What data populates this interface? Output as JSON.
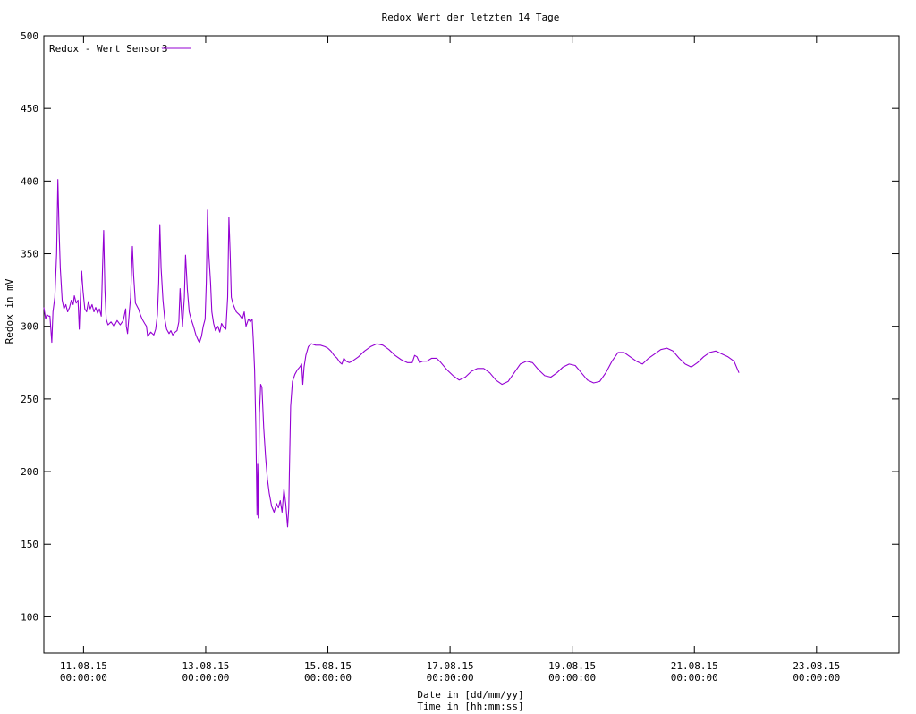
{
  "chart_data": {
    "type": "line",
    "title": "Redox Wert der letzten 14 Tage",
    "ylabel": "Redox in mV",
    "xlabel_lines": [
      "Date in [dd/mm/yy]",
      "Time in [hh:mm:ss]"
    ],
    "ylim": [
      75,
      500
    ],
    "y_ticks": [
      100,
      150,
      200,
      250,
      300,
      350,
      400,
      450,
      500
    ],
    "xlim": [
      -0.65,
      13.35
    ],
    "x_ticks": [
      {
        "x": 0,
        "date": "11.08.15",
        "time": "00:00:00"
      },
      {
        "x": 2,
        "date": "13.08.15",
        "time": "00:00:00"
      },
      {
        "x": 4,
        "date": "15.08.15",
        "time": "00:00:00"
      },
      {
        "x": 6,
        "date": "17.08.15",
        "time": "00:00:00"
      },
      {
        "x": 8,
        "date": "19.08.15",
        "time": "00:00:00"
      },
      {
        "x": 10,
        "date": "21.08.15",
        "time": "00:00:00"
      },
      {
        "x": 12,
        "date": "23.08.15",
        "time": "00:00:00"
      }
    ],
    "x_unit_note": "x in days relative to 11.08.15 00:00:00",
    "legend_position": "top-left",
    "grid": false,
    "series": [
      {
        "name": "Redox - Wert Sensor3",
        "color": "#9400d3",
        "points": [
          [
            -0.65,
            313
          ],
          [
            -0.62,
            305
          ],
          [
            -0.6,
            308
          ],
          [
            -0.57,
            307
          ],
          [
            -0.55,
            307
          ],
          [
            -0.52,
            289
          ],
          [
            -0.5,
            310
          ],
          [
            -0.47,
            320
          ],
          [
            -0.44,
            350
          ],
          [
            -0.42,
            401
          ],
          [
            -0.4,
            365
          ],
          [
            -0.38,
            340
          ],
          [
            -0.35,
            318
          ],
          [
            -0.32,
            312
          ],
          [
            -0.29,
            315
          ],
          [
            -0.26,
            310
          ],
          [
            -0.23,
            313
          ],
          [
            -0.2,
            318
          ],
          [
            -0.17,
            315
          ],
          [
            -0.15,
            321
          ],
          [
            -0.12,
            316
          ],
          [
            -0.09,
            318
          ],
          [
            -0.07,
            298
          ],
          [
            -0.05,
            322
          ],
          [
            -0.03,
            338
          ],
          [
            -0.01,
            325
          ],
          [
            0.02,
            312
          ],
          [
            0.05,
            310
          ],
          [
            0.08,
            317
          ],
          [
            0.11,
            312
          ],
          [
            0.14,
            315
          ],
          [
            0.17,
            310
          ],
          [
            0.2,
            313
          ],
          [
            0.23,
            309
          ],
          [
            0.26,
            312
          ],
          [
            0.29,
            307
          ],
          [
            0.31,
            340
          ],
          [
            0.33,
            366
          ],
          [
            0.35,
            325
          ],
          [
            0.37,
            305
          ],
          [
            0.4,
            301
          ],
          [
            0.45,
            303
          ],
          [
            0.5,
            300
          ],
          [
            0.55,
            304
          ],
          [
            0.6,
            301
          ],
          [
            0.65,
            304
          ],
          [
            0.69,
            312
          ],
          [
            0.7,
            300
          ],
          [
            0.72,
            295
          ],
          [
            0.75,
            310
          ],
          [
            0.77,
            320
          ],
          [
            0.8,
            355
          ],
          [
            0.82,
            335
          ],
          [
            0.85,
            316
          ],
          [
            0.9,
            312
          ],
          [
            0.93,
            308
          ],
          [
            0.96,
            305
          ],
          [
            1.0,
            302
          ],
          [
            1.03,
            300
          ],
          [
            1.05,
            293
          ],
          [
            1.1,
            296
          ],
          [
            1.15,
            294
          ],
          [
            1.18,
            298
          ],
          [
            1.21,
            308
          ],
          [
            1.23,
            330
          ],
          [
            1.25,
            370
          ],
          [
            1.27,
            340
          ],
          [
            1.3,
            318
          ],
          [
            1.33,
            305
          ],
          [
            1.36,
            298
          ],
          [
            1.4,
            295
          ],
          [
            1.43,
            297
          ],
          [
            1.46,
            294
          ],
          [
            1.5,
            296
          ],
          [
            1.53,
            297
          ],
          [
            1.56,
            303
          ],
          [
            1.58,
            326
          ],
          [
            1.6,
            312
          ],
          [
            1.62,
            300
          ],
          [
            1.65,
            320
          ],
          [
            1.67,
            349
          ],
          [
            1.7,
            325
          ],
          [
            1.73,
            310
          ],
          [
            1.76,
            305
          ],
          [
            1.8,
            300
          ],
          [
            1.84,
            294
          ],
          [
            1.88,
            290
          ],
          [
            1.9,
            289
          ],
          [
            1.93,
            293
          ],
          [
            1.96,
            300
          ],
          [
            1.99,
            305
          ],
          [
            2.01,
            330
          ],
          [
            2.03,
            380
          ],
          [
            2.05,
            350
          ],
          [
            2.08,
            330
          ],
          [
            2.1,
            310
          ],
          [
            2.13,
            302
          ],
          [
            2.16,
            297
          ],
          [
            2.2,
            300
          ],
          [
            2.23,
            296
          ],
          [
            2.26,
            302
          ],
          [
            2.3,
            299
          ],
          [
            2.33,
            298
          ],
          [
            2.36,
            320
          ],
          [
            2.38,
            375
          ],
          [
            2.4,
            350
          ],
          [
            2.42,
            320
          ],
          [
            2.45,
            315
          ],
          [
            2.5,
            310
          ],
          [
            2.55,
            308
          ],
          [
            2.6,
            305
          ],
          [
            2.63,
            310
          ],
          [
            2.66,
            300
          ],
          [
            2.7,
            305
          ],
          [
            2.73,
            303
          ],
          [
            2.76,
            305
          ],
          [
            2.78,
            290
          ],
          [
            2.8,
            270
          ],
          [
            2.82,
            230
          ],
          [
            2.84,
            170
          ],
          [
            2.85,
            205
          ],
          [
            2.86,
            168
          ],
          [
            2.88,
            240
          ],
          [
            2.9,
            260
          ],
          [
            2.92,
            258
          ],
          [
            2.95,
            230
          ],
          [
            2.98,
            210
          ],
          [
            3.01,
            195
          ],
          [
            3.04,
            185
          ],
          [
            3.08,
            176
          ],
          [
            3.12,
            172
          ],
          [
            3.16,
            178
          ],
          [
            3.19,
            175
          ],
          [
            3.22,
            180
          ],
          [
            3.25,
            172
          ],
          [
            3.28,
            188
          ],
          [
            3.31,
            178
          ],
          [
            3.34,
            162
          ],
          [
            3.36,
            175
          ],
          [
            3.37,
            200
          ],
          [
            3.39,
            245
          ],
          [
            3.42,
            262
          ],
          [
            3.46,
            267
          ],
          [
            3.5,
            270
          ],
          [
            3.54,
            272
          ],
          [
            3.57,
            274
          ],
          [
            3.59,
            260
          ],
          [
            3.61,
            272
          ],
          [
            3.64,
            280
          ],
          [
            3.68,
            286
          ],
          [
            3.73,
            288
          ],
          [
            3.8,
            287
          ],
          [
            3.88,
            287
          ],
          [
            3.95,
            286
          ],
          [
            4.0,
            285
          ],
          [
            4.05,
            283
          ],
          [
            4.1,
            280
          ],
          [
            4.15,
            278
          ],
          [
            4.2,
            275
          ],
          [
            4.23,
            274
          ],
          [
            4.26,
            278
          ],
          [
            4.3,
            276
          ],
          [
            4.35,
            275
          ],
          [
            4.4,
            276
          ],
          [
            4.5,
            279
          ],
          [
            4.6,
            283
          ],
          [
            4.7,
            286
          ],
          [
            4.8,
            288
          ],
          [
            4.9,
            287
          ],
          [
            5.0,
            284
          ],
          [
            5.1,
            280
          ],
          [
            5.2,
            277
          ],
          [
            5.3,
            275
          ],
          [
            5.38,
            275
          ],
          [
            5.42,
            280
          ],
          [
            5.46,
            279
          ],
          [
            5.5,
            275
          ],
          [
            5.55,
            276
          ],
          [
            5.62,
            276
          ],
          [
            5.7,
            278
          ],
          [
            5.78,
            278
          ],
          [
            5.85,
            275
          ],
          [
            5.95,
            270
          ],
          [
            6.05,
            266
          ],
          [
            6.15,
            263
          ],
          [
            6.25,
            265
          ],
          [
            6.35,
            269
          ],
          [
            6.45,
            271
          ],
          [
            6.55,
            271
          ],
          [
            6.65,
            268
          ],
          [
            6.75,
            263
          ],
          [
            6.85,
            260
          ],
          [
            6.95,
            262
          ],
          [
            7.05,
            268
          ],
          [
            7.15,
            274
          ],
          [
            7.25,
            276
          ],
          [
            7.35,
            275
          ],
          [
            7.45,
            270
          ],
          [
            7.55,
            266
          ],
          [
            7.65,
            265
          ],
          [
            7.75,
            268
          ],
          [
            7.85,
            272
          ],
          [
            7.95,
            274
          ],
          [
            8.05,
            273
          ],
          [
            8.15,
            268
          ],
          [
            8.25,
            263
          ],
          [
            8.35,
            261
          ],
          [
            8.45,
            262
          ],
          [
            8.55,
            268
          ],
          [
            8.65,
            276
          ],
          [
            8.75,
            282
          ],
          [
            8.85,
            282
          ],
          [
            8.95,
            279
          ],
          [
            9.05,
            276
          ],
          [
            9.15,
            274
          ],
          [
            9.25,
            278
          ],
          [
            9.35,
            281
          ],
          [
            9.45,
            284
          ],
          [
            9.55,
            285
          ],
          [
            9.65,
            283
          ],
          [
            9.75,
            278
          ],
          [
            9.85,
            274
          ],
          [
            9.95,
            272
          ],
          [
            10.05,
            275
          ],
          [
            10.15,
            279
          ],
          [
            10.25,
            282
          ],
          [
            10.35,
            283
          ],
          [
            10.45,
            281
          ],
          [
            10.55,
            279
          ],
          [
            10.65,
            276
          ],
          [
            10.7,
            271
          ],
          [
            10.73,
            268
          ]
        ]
      }
    ]
  }
}
